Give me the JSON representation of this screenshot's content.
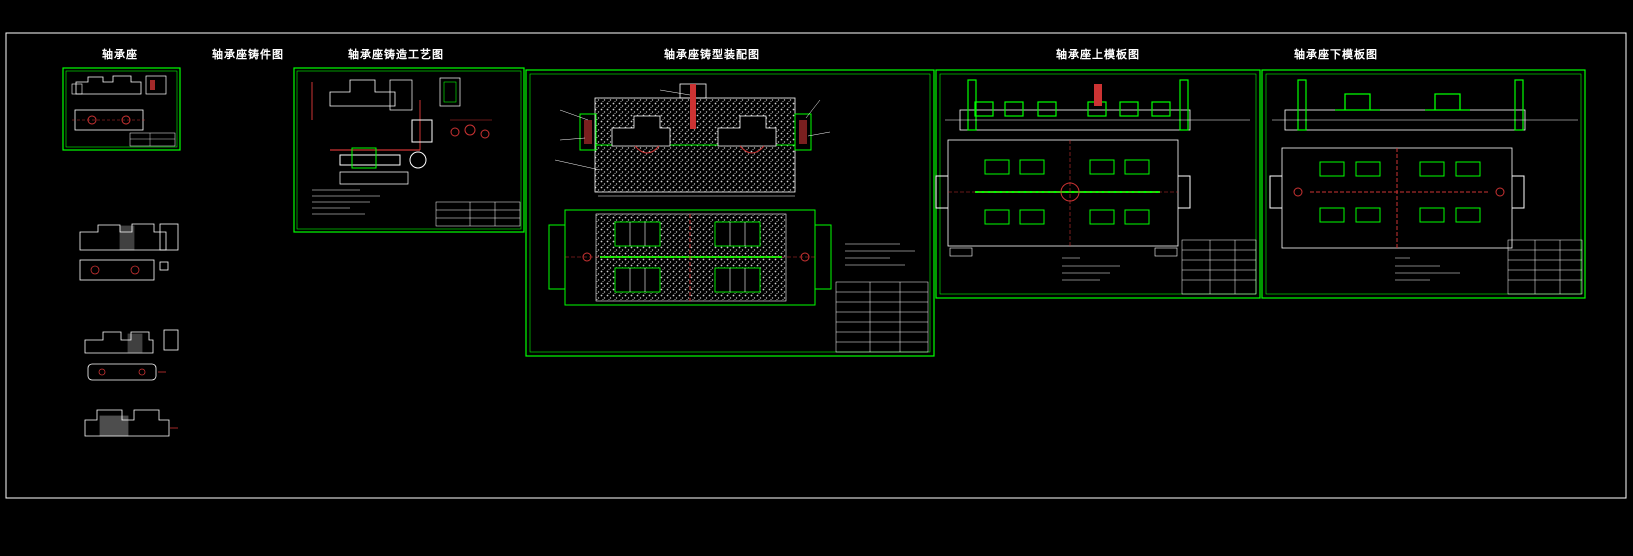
{
  "titles": {
    "t1": "轴承座",
    "t2": "轴承座铸件图",
    "t3": "轴承座铸造工艺图",
    "t4": "轴承座铸型装配图",
    "t5": "轴承座上模板图",
    "t6": "轴承座下模板图"
  },
  "colors": {
    "background": "#000000",
    "frame": "#ffffff",
    "sheet_border": "#00ff00",
    "part_line": "#00ff00",
    "center_line": "#ff3333",
    "sand_fill": "#cfcfcf",
    "text": "#ffffff"
  }
}
